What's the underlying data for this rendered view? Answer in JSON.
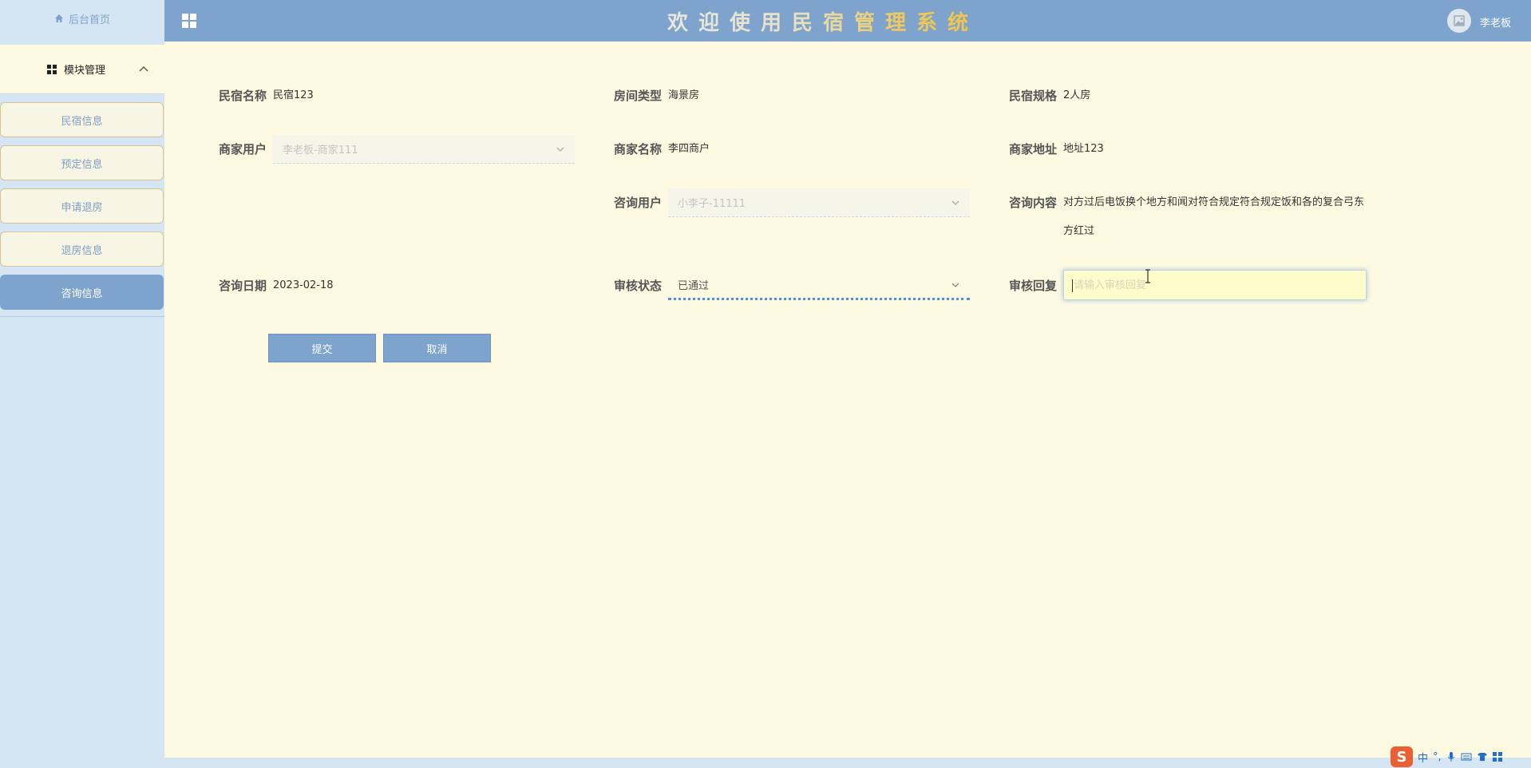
{
  "sidebar": {
    "home_label": "后台首页",
    "module_label": "模块管理",
    "items": [
      {
        "label": "民宿信息"
      },
      {
        "label": "预定信息"
      },
      {
        "label": "申请退房"
      },
      {
        "label": "退房信息"
      },
      {
        "label": "咨询信息"
      }
    ]
  },
  "header": {
    "title": "欢迎使用民宿管理系统",
    "username": "李老板"
  },
  "form": {
    "minsu_name": {
      "label": "民宿名称",
      "value": "民宿123"
    },
    "room_type": {
      "label": "房间类型",
      "value": "海景房"
    },
    "minsu_spec": {
      "label": "民宿规格",
      "value": "2人房"
    },
    "merchant_user": {
      "label": "商家用户",
      "value": "李老板-商家111"
    },
    "merchant_name": {
      "label": "商家名称",
      "value": "李四商户"
    },
    "merchant_address": {
      "label": "商家地址",
      "value": "地址123"
    },
    "consult_user": {
      "label": "咨询用户",
      "value": "小李子-11111"
    },
    "consult_content": {
      "label": "咨询内容",
      "value": "对方过后电饭换个地方和闻对符合规定符合规定饭和各的复合弓东方红过"
    },
    "consult_date": {
      "label": "咨询日期",
      "value": "2023-02-18"
    },
    "review_status": {
      "label": "审核状态",
      "value": "已通过"
    },
    "review_reply": {
      "label": "审核回复",
      "placeholder": "请输入审核回复"
    }
  },
  "buttons": {
    "submit": "提交",
    "cancel": "取消"
  },
  "ime": {
    "logo": "S",
    "lang": "中",
    "punct": "°,"
  },
  "colors": {
    "sidebar_bg": "#d6e5f3",
    "topbar_bg": "#7ea4cd",
    "content_bg": "#fdfae1",
    "accent": "#7ea4cd",
    "title_gold": "#f2c448"
  }
}
